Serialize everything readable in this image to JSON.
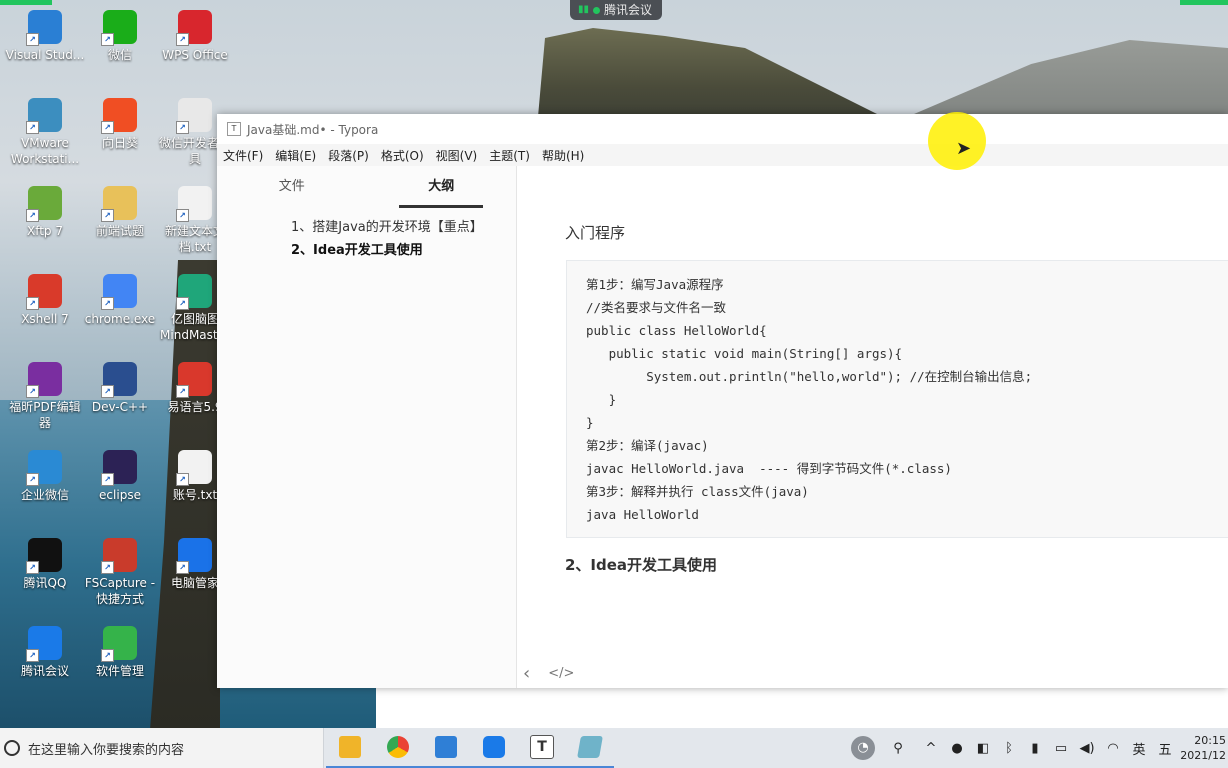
{
  "meeting_pill": {
    "label": "腾讯会议"
  },
  "desktop_icons": [
    {
      "label": "Visual Stud...",
      "color": "#2a7fd4"
    },
    {
      "label": "微信",
      "color": "#1aad19"
    },
    {
      "label": "WPS Office",
      "color": "#d8262d"
    },
    {
      "label": "VMware Workstati...",
      "color": "#3c8ebf"
    },
    {
      "label": "向日葵",
      "color": "#f04e23"
    },
    {
      "label": "微信开发者工具",
      "color": "#e8e8e8"
    },
    {
      "label": "Xftp 7",
      "color": "#6aaa3a"
    },
    {
      "label": "前端试题",
      "color": "#e8c15a"
    },
    {
      "label": "新建文本文档.txt",
      "color": "#f2f2f2"
    },
    {
      "label": "Xshell 7",
      "color": "#d93a2a"
    },
    {
      "label": "chrome.exe",
      "color": "#4285f4"
    },
    {
      "label": "亿图脑图MindMaster",
      "color": "#1fa67a"
    },
    {
      "label": "福昕PDF编辑器",
      "color": "#7a2ea0"
    },
    {
      "label": "Dev-C++",
      "color": "#2a4e8f"
    },
    {
      "label": "易语言5.9",
      "color": "#d9382c"
    },
    {
      "label": "企业微信",
      "color": "#2a8ad4"
    },
    {
      "label": "eclipse",
      "color": "#2c2255"
    },
    {
      "label": "账号.txt",
      "color": "#f2f2f2"
    },
    {
      "label": "腾讯QQ",
      "color": "#111111"
    },
    {
      "label": "FSCapture - 快捷方式",
      "color": "#c93b2b"
    },
    {
      "label": "电脑管家",
      "color": "#1a72e8"
    },
    {
      "label": "腾讯会议",
      "color": "#1a7ae8"
    },
    {
      "label": "软件管理",
      "color": "#35b34a"
    }
  ],
  "window": {
    "title": "Java基础.md• - Typora",
    "app_icon": "T"
  },
  "menu": [
    "文件(F)",
    "编辑(E)",
    "段落(P)",
    "格式(O)",
    "视图(V)",
    "主题(T)",
    "帮助(H)"
  ],
  "sidebar": {
    "tabs": [
      "文件",
      "大纲"
    ],
    "active_tab": "大纲",
    "outline": [
      "1、搭建Java的开发环境【重点】",
      "2、Idea开发工具使用"
    ],
    "footer_icons": [
      "‹",
      "</>"
    ]
  },
  "editor": {
    "paragraph": "入门程序",
    "code_lines": [
      "第1步：编写Java源程序",
      "//类名要求与文件名一致",
      "public class HelloWorld{",
      "   public static void main(String[] args){",
      "        System.out.println(\"hello,world\"); //在控制台输出信息;",
      "   }",
      "}",
      "第2步：编译(javac)",
      "javac HelloWorld.java  ---- 得到字节码文件(*.class)",
      "第3步：解释并执行 class文件(java)",
      "java HelloWorld"
    ],
    "heading": "2、Idea开发工具使用"
  },
  "taskbar": {
    "search_placeholder": "在这里输入你要搜索的内容",
    "apps": [
      {
        "name": "file-explorer",
        "color": "#f0b429"
      },
      {
        "name": "chrome",
        "color": "#4285f4"
      },
      {
        "name": "tencent-meeting-ui",
        "color": "#2f7fd6"
      },
      {
        "name": "tencent-meeting",
        "color": "#1a7ae8"
      },
      {
        "name": "typora",
        "color": "#333333"
      },
      {
        "name": "notepad",
        "color": "#6fb3c9"
      }
    ],
    "tray_ime": "英",
    "tray_extra": "五",
    "clock_time": "20:15",
    "clock_date": "2021/12"
  }
}
